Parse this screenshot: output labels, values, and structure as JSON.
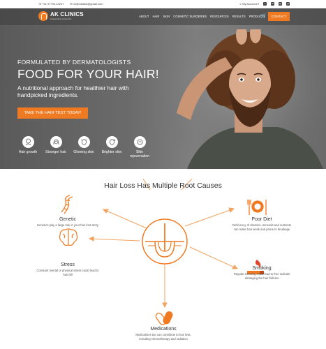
{
  "topbar": {
    "phone": "+91 97799-44207",
    "email": "ne@radiant@gmail.com",
    "account": "My Account",
    "social": [
      "f",
      "in",
      "ig",
      "yt"
    ]
  },
  "nav": {
    "logo_name": "AK CLINICS",
    "logo_tagline": "independent perspective",
    "menu": [
      "ABOUT",
      "HAIR",
      "SKIN",
      "COSMETIC SURGERIES",
      "RESOURCES",
      "RESULTS",
      "PRODUCTS"
    ],
    "contact": "CONTACT"
  },
  "hero": {
    "kicker": "FORMULATED BY DERMATOLOGISTS",
    "title": "FOOD FOR YOUR HAIR!",
    "subtitle": "A nutritional approach for healthier hair with handpicked ingredients.",
    "cta": "TAKE THE HAIR TEST TODAY!",
    "features": [
      {
        "icon": "hair-growth-icon",
        "label": "Hair growth"
      },
      {
        "icon": "stronger-hair-icon",
        "label": "Stronger hair"
      },
      {
        "icon": "glowing-skin-icon",
        "label": "Glowing skin"
      },
      {
        "icon": "brighter-skin-icon",
        "label": "Brighter skin"
      },
      {
        "icon": "skin-rejuvenation-icon",
        "label": "Skin rejuvenation"
      }
    ]
  },
  "causes": {
    "title": "Hair Loss Has Multiple Root Causes",
    "genetic": {
      "title": "Genetic",
      "desc": "Genetics play a large role in your hair loss story"
    },
    "poor_diet": {
      "title": "Poor Diet",
      "desc": "Deficiency of vitamins, minerals and nutrients can make hair weak and prone to breakage"
    },
    "stress": {
      "title": "Stress",
      "desc": "Constant mental or physical stress could lead to hair fall"
    },
    "smoking": {
      "title": "Smoking",
      "desc": "Regular smoking could lead to free radicals damaging the hair follicles"
    },
    "medications": {
      "title": "Medications",
      "desc": "Medications too can contribute to hair loss, including chemotherapy and radiation"
    }
  },
  "colors": {
    "accent": "#f07a22",
    "hero_bg": "#6b6b6b"
  }
}
